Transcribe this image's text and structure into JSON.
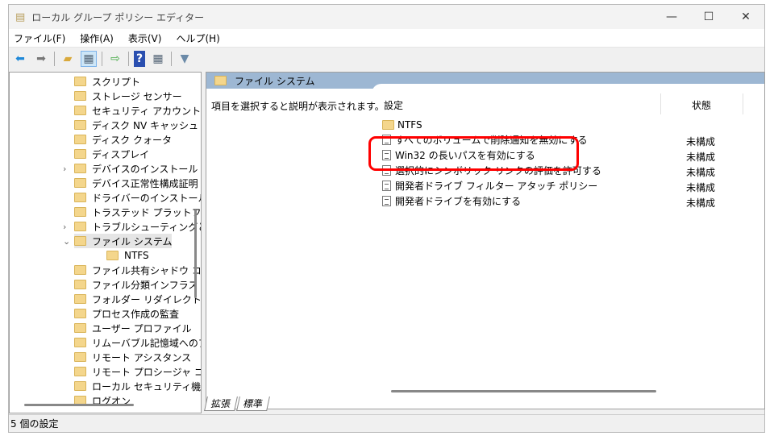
{
  "window": {
    "title": "ローカル グループ ポリシー エディター",
    "minimize": "—",
    "maximize": "☐",
    "close": "✕"
  },
  "menu": [
    "ファイル(F)",
    "操作(A)",
    "表示(V)",
    "ヘルプ(H)"
  ],
  "toolbar": [
    "back-icon",
    "forward-icon",
    "up-folder-icon",
    "show-hide-tree-icon",
    "export-list-icon",
    "help-icon",
    "show-action-pane-icon",
    "filter-icon"
  ],
  "tree": [
    {
      "label": "スクリプト"
    },
    {
      "label": "ストレージ センサー"
    },
    {
      "label": "セキュリティ アカウント マネ"
    },
    {
      "label": "ディスク NV キャッシュ"
    },
    {
      "label": "ディスク クォータ"
    },
    {
      "label": "ディスプレイ"
    },
    {
      "label": "デバイスのインストール",
      "expander": "›"
    },
    {
      "label": "デバイス正常性構成証明"
    },
    {
      "label": "ドライバーのインストール"
    },
    {
      "label": "トラステッド プラットフォーム"
    },
    {
      "label": "トラブルシューティングと診断",
      "expander": "›"
    },
    {
      "label": "ファイル システム",
      "expander": "⌄",
      "selected": true
    },
    {
      "label": "NTFS",
      "child": true
    },
    {
      "label": "ファイル共有シャドウ コピー"
    },
    {
      "label": "ファイル分類インフラストラ"
    },
    {
      "label": "フォルダー リダイレクト"
    },
    {
      "label": "プロセス作成の監査"
    },
    {
      "label": "ユーザー プロファイル"
    },
    {
      "label": "リムーバブル記憶域へのア"
    },
    {
      "label": "リモート アシスタンス"
    },
    {
      "label": "リモート プロシージャ コール"
    },
    {
      "label": "ローカル セキュリティ機関"
    },
    {
      "label": "ログオン"
    }
  ],
  "right": {
    "header": "ファイル システム",
    "description": "項目を選択すると説明が表示されます。",
    "columns": {
      "setting": "設定",
      "state": "状態"
    },
    "folder": "NTFS",
    "rows": [
      {
        "label": "すべてのボリュームで削除通知を無効にする",
        "state": "未構成"
      },
      {
        "label": "Win32 の長いパスを有効にする",
        "state": "未構成",
        "highlighted": true
      },
      {
        "label": "選択的にシンボリック リンクの評価を許可する",
        "state": "未構成"
      },
      {
        "label": "開発者ドライブ フィルター アタッチ ポリシー",
        "state": "未構成"
      },
      {
        "label": "開発者ドライブを有効にする",
        "state": "未構成"
      }
    ],
    "highlight_color": "#ff0000"
  },
  "tabs": [
    "拡張",
    "標準"
  ],
  "status": "5 個の設定"
}
